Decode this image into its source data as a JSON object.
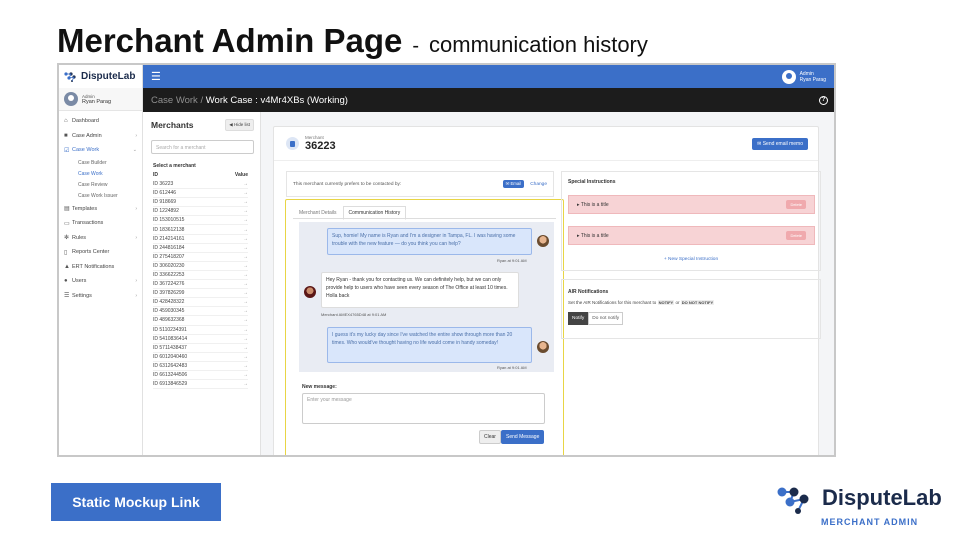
{
  "slide": {
    "title": "Merchant Admin Page",
    "dash": "-",
    "subtitle": "communication history",
    "mockup_button": "Static Mockup Link",
    "logo_name": "DisputeLab",
    "logo_tagline": "MERCHANT ADMIN"
  },
  "app": {
    "brand": "DisputeLab",
    "top_user_role": "Admin",
    "top_user_name": "Ryan Parag"
  },
  "sidebar": {
    "user_role": "Admin",
    "user_name": "Ryan Parag",
    "items": [
      {
        "label": "Dashboard",
        "icon": "home-icon"
      },
      {
        "label": "Case Admin",
        "icon": "briefcase-icon"
      },
      {
        "label": "Case Work",
        "icon": "checkbox-icon"
      },
      {
        "label": "Case Builder"
      },
      {
        "label": "Case Work"
      },
      {
        "label": "Case Review"
      },
      {
        "label": "Case Work Issuer"
      },
      {
        "label": "Templates",
        "icon": "template-icon"
      },
      {
        "label": "Transactions",
        "icon": "card-icon"
      },
      {
        "label": "Rules",
        "icon": "gear-icon"
      },
      {
        "label": "Reports Center",
        "icon": "file-icon"
      },
      {
        "label": "ERT Notifications",
        "icon": "warning-icon"
      },
      {
        "label": "Users",
        "icon": "users-icon"
      },
      {
        "label": "Settings",
        "icon": "sliders-icon"
      }
    ]
  },
  "header": {
    "breadcrumb_parent": "Case Work /",
    "breadcrumb_current": "Work Case : v4Mr4XBs (Working)"
  },
  "merchants": {
    "title": "Merchants",
    "hide_button": "Hide list",
    "search_placeholder": "Search for a merchant",
    "select_label": "Select a merchant",
    "col_id": "ID",
    "col_value": "Value",
    "ids": [
      "ID 36223",
      "ID 612446",
      "ID 918669",
      "ID 1224892",
      "ID 153010515",
      "ID 183612138",
      "ID 214214161",
      "ID 244816184",
      "ID 275418207",
      "ID 306020230",
      "ID 336622253",
      "ID 367224276",
      "ID 397826299",
      "ID 428428322",
      "ID 459030345",
      "ID 489632368",
      "ID 5110234391",
      "ID 5410836414",
      "ID 5711438437",
      "ID 6012040460",
      "ID 6312642483",
      "ID 6613244506",
      "ID 6913846529"
    ],
    "arrow": "→"
  },
  "merchant": {
    "label": "Merchant",
    "id": "36223",
    "send_memo": "Send email memo",
    "contact_pref": "This merchant currently prefers to be contacted by:",
    "contact_method": "Email",
    "change": "Change"
  },
  "chat": {
    "tabs": [
      "Merchant Details",
      "Communication History"
    ],
    "messages": [
      {
        "text": "Sup, homie! My name is Ryan and I'm a designer in Tampa, FL. I was having some trouble with the new feature — do you think you can help?",
        "meta": "Ryan at 9:01 AM"
      },
      {
        "text": "Hey Ryan - thank you for contacting us. We can definitely help, but we can only provide help to users who have seen every season of The Office at least 10 times. Holla back",
        "meta": "Merchant AMEX4765D48 at 9:01 AM"
      },
      {
        "text": "I guess it's my lucky day since I've watched the entire show through more than 20 times. Who would've thought having no life would come in handy someday!",
        "meta": "Ryan at 9:01 AM"
      }
    ],
    "new_message_label": "New message:",
    "input_placeholder": "Enter your message",
    "clear": "Clear",
    "send": "Send Message"
  },
  "special": {
    "title": "Special Instructions",
    "items": [
      "This is a title",
      "This is a title"
    ],
    "delete": "Delete",
    "add": "+ New Special Instruction"
  },
  "air": {
    "title": "AIR Notifications",
    "desc_prefix": "Set the AIR Notifications for this merchant to",
    "code_notify": "NOTIFY",
    "or": "or",
    "code_do_not": "DO NOT NOTIFY",
    "btn_notify": "Notify",
    "btn_do_not": "Do not notify"
  },
  "colors": {
    "accent": "#3b6fc8",
    "highlight": "#e8d545",
    "dark_header": "#1c1c1c"
  }
}
